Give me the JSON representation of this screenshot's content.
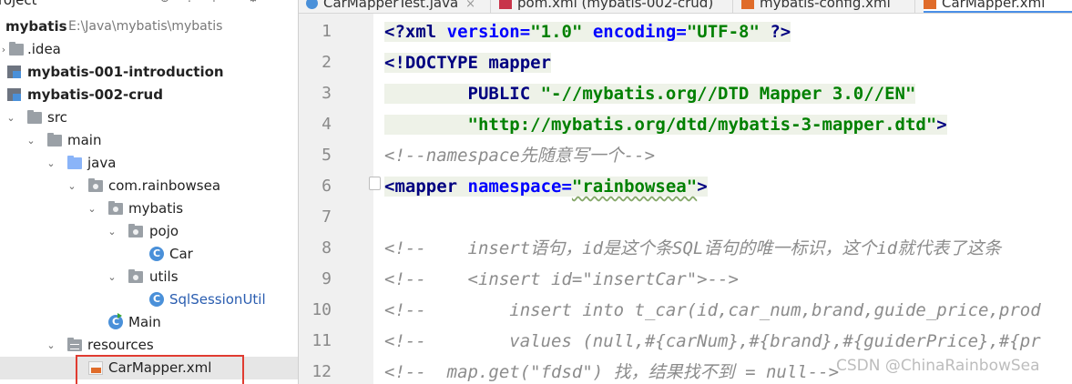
{
  "project": {
    "header_title": "roject",
    "root_name": "mybatis",
    "root_path": "E:\\Java\\mybatis\\mybatis",
    "items": [
      {
        "label": ".idea"
      },
      {
        "label": "mybatis-001-introduction"
      },
      {
        "label": "mybatis-002-crud"
      },
      {
        "label": "src"
      },
      {
        "label": "main"
      },
      {
        "label": "java"
      },
      {
        "label": "com.rainbowsea"
      },
      {
        "label": "mybatis"
      },
      {
        "label": "pojo"
      },
      {
        "label": "Car"
      },
      {
        "label": "utils"
      },
      {
        "label": "SqlSessionUtil"
      },
      {
        "label": "Main"
      },
      {
        "label": "resources"
      },
      {
        "label": "CarMapper.xml"
      }
    ]
  },
  "tabs": [
    {
      "label": "CarMapperTest.java"
    },
    {
      "label": "pom.xml (mybatis-002-crud)"
    },
    {
      "label": "mybatis-config.xml"
    },
    {
      "label": "CarMapper.xml"
    }
  ],
  "editor": {
    "line_numbers": [
      "1",
      "2",
      "3",
      "4",
      "5",
      "6",
      "7",
      "8",
      "9",
      "10",
      "11",
      "12"
    ],
    "lines": {
      "l1": {
        "a": "<?",
        "b": "xml ",
        "c": "version",
        "d": "=",
        "e": "\"1.0\"",
        "f": " ",
        "g": "encoding",
        "h": "=",
        "i": "\"UTF-8\"",
        "j": " ?>"
      },
      "l2": {
        "a": "<!DOCTYPE ",
        "b": "mapper"
      },
      "l3": {
        "a": "        PUBLIC ",
        "b": "\"-//mybatis.org//DTD Mapper 3.0//EN\""
      },
      "l4": {
        "a": "        ",
        "b": "\"http://mybatis.org/dtd/mybatis-3-mapper.dtd\"",
        "c": ">"
      },
      "l5": {
        "a": "<!--namespace先随意写一个-->"
      },
      "l6": {
        "a": "<mapper ",
        "b": "namespace",
        "c": "=",
        "d": "\"rainbowsea\"",
        "e": ">"
      },
      "l8": {
        "a": "<!--    insert语句，id是这个条SQL语句的唯一标识，这个id就代表了这条"
      },
      "l9": {
        "a": "<!--    <insert id=\"insertCar\">-->"
      },
      "l10": {
        "a": "<!--        insert into t_car(id,car_num,brand,guide_price,prod"
      },
      "l11": {
        "a": "<!--        values (null,#{carNum},#{brand},#{guiderPrice},#{pr"
      },
      "l12": {
        "a": "<!--  map.get(\"fdsd\") 找，结果找不到 = null-->"
      }
    }
  },
  "watermark": "CSDN @ChinaRainbowSea",
  "colors": {
    "keyword": "#000080",
    "attribute": "#0000ff",
    "string": "#008000",
    "comment": "#8c8c8c",
    "selection_box": "#e03c31",
    "active_tab_underline": "#4a8fe7"
  }
}
